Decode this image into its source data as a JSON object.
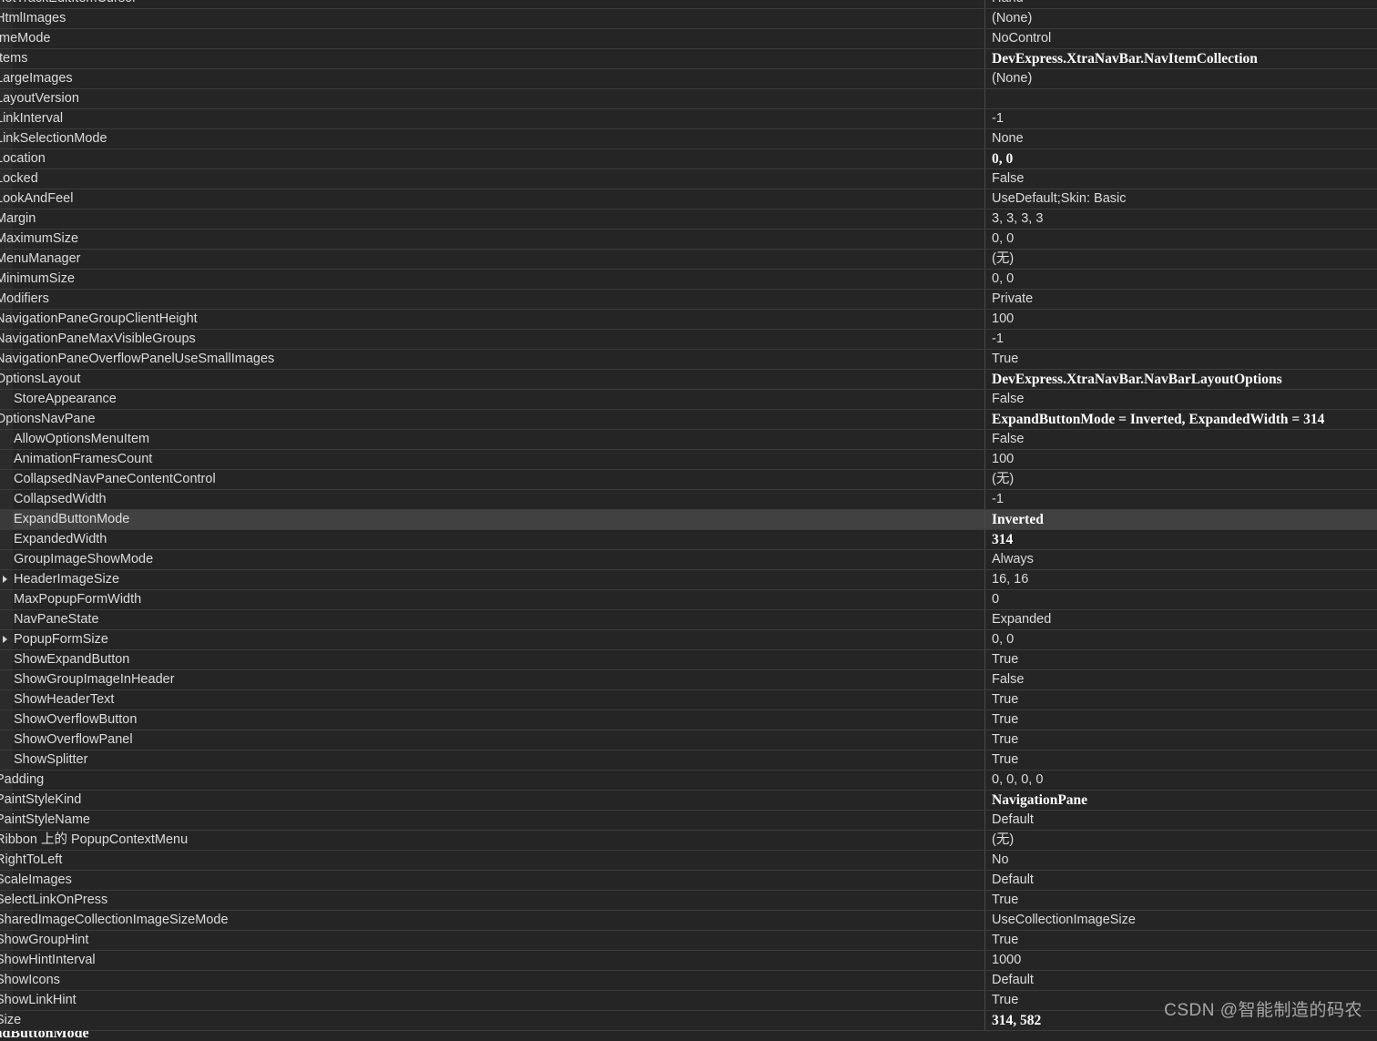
{
  "window": {
    "kind": "visual-studio-properties-grid",
    "theme": "dark",
    "background_color": "#252526",
    "selected_row_color": "#414141",
    "gridline_color": "#3b3b3c",
    "text_color": "#dcdcdc",
    "bold_text_color": "#ffffff"
  },
  "watermark": {
    "text": "CSDN @智能制造的码农"
  },
  "description_pane": {
    "title": "ExpandButtonMode"
  },
  "grid": {
    "selected_property": "ExpandButtonMode",
    "rows": [
      {
        "name": "HotTrackEditItemCursor",
        "value": "Hand",
        "indent": 0,
        "expandable": false,
        "bold": false,
        "selected": false
      },
      {
        "name": "HtmlImages",
        "value": "(None)",
        "indent": 0,
        "expandable": false,
        "bold": false,
        "selected": false
      },
      {
        "name": "ImeMode",
        "value": "NoControl",
        "indent": 0,
        "expandable": false,
        "bold": false,
        "selected": false
      },
      {
        "name": "Items",
        "value": "DevExpress.XtraNavBar.NavItemCollection",
        "indent": 0,
        "expandable": false,
        "bold": true,
        "selected": false
      },
      {
        "name": "LargeImages",
        "value": "(None)",
        "indent": 0,
        "expandable": false,
        "bold": false,
        "selected": false
      },
      {
        "name": "LayoutVersion",
        "value": "",
        "indent": 0,
        "expandable": false,
        "bold": false,
        "selected": false
      },
      {
        "name": "LinkInterval",
        "value": "-1",
        "indent": 0,
        "expandable": false,
        "bold": false,
        "selected": false
      },
      {
        "name": "LinkSelectionMode",
        "value": "None",
        "indent": 0,
        "expandable": false,
        "bold": false,
        "selected": false
      },
      {
        "name": "Location",
        "value": "0, 0",
        "indent": 0,
        "expandable": false,
        "bold": true,
        "selected": false
      },
      {
        "name": "Locked",
        "value": "False",
        "indent": 0,
        "expandable": false,
        "bold": false,
        "selected": false
      },
      {
        "name": "LookAndFeel",
        "value": "UseDefault;Skin: Basic",
        "indent": 0,
        "expandable": false,
        "bold": false,
        "selected": false
      },
      {
        "name": "Margin",
        "value": "3, 3, 3, 3",
        "indent": 0,
        "expandable": false,
        "bold": false,
        "selected": false
      },
      {
        "name": "MaximumSize",
        "value": "0, 0",
        "indent": 0,
        "expandable": false,
        "bold": false,
        "selected": false
      },
      {
        "name": "MenuManager",
        "value": "(无)",
        "indent": 0,
        "expandable": false,
        "bold": false,
        "selected": false
      },
      {
        "name": "MinimumSize",
        "value": "0, 0",
        "indent": 0,
        "expandable": false,
        "bold": false,
        "selected": false
      },
      {
        "name": "Modifiers",
        "value": "Private",
        "indent": 0,
        "expandable": false,
        "bold": false,
        "selected": false
      },
      {
        "name": "NavigationPaneGroupClientHeight",
        "value": "100",
        "indent": 0,
        "expandable": false,
        "bold": false,
        "selected": false
      },
      {
        "name": "NavigationPaneMaxVisibleGroups",
        "value": "-1",
        "indent": 0,
        "expandable": false,
        "bold": false,
        "selected": false
      },
      {
        "name": "NavigationPaneOverflowPanelUseSmallImages",
        "value": "True",
        "indent": 0,
        "expandable": false,
        "bold": false,
        "selected": false
      },
      {
        "name": "OptionsLayout",
        "value": "DevExpress.XtraNavBar.NavBarLayoutOptions",
        "indent": 0,
        "expandable": false,
        "bold": true,
        "selected": false
      },
      {
        "name": "StoreAppearance",
        "value": "False",
        "indent": 1,
        "expandable": false,
        "bold": false,
        "selected": false
      },
      {
        "name": "OptionsNavPane",
        "value": "ExpandButtonMode = Inverted, ExpandedWidth = 314",
        "indent": 0,
        "expandable": false,
        "bold": true,
        "selected": false
      },
      {
        "name": "AllowOptionsMenuItem",
        "value": "False",
        "indent": 1,
        "expandable": false,
        "bold": false,
        "selected": false
      },
      {
        "name": "AnimationFramesCount",
        "value": "100",
        "indent": 1,
        "expandable": false,
        "bold": false,
        "selected": false
      },
      {
        "name": "CollapsedNavPaneContentControl",
        "value": "(无)",
        "indent": 1,
        "expandable": false,
        "bold": false,
        "selected": false
      },
      {
        "name": "CollapsedWidth",
        "value": "-1",
        "indent": 1,
        "expandable": false,
        "bold": false,
        "selected": false
      },
      {
        "name": "ExpandButtonMode",
        "value": "Inverted",
        "indent": 1,
        "expandable": false,
        "bold": true,
        "selected": true
      },
      {
        "name": "ExpandedWidth",
        "value": "314",
        "indent": 1,
        "expandable": false,
        "bold": true,
        "selected": false
      },
      {
        "name": "GroupImageShowMode",
        "value": "Always",
        "indent": 1,
        "expandable": false,
        "bold": false,
        "selected": false
      },
      {
        "name": "HeaderImageSize",
        "value": "16, 16",
        "indent": 1,
        "expandable": true,
        "bold": false,
        "selected": false
      },
      {
        "name": "MaxPopupFormWidth",
        "value": "0",
        "indent": 1,
        "expandable": false,
        "bold": false,
        "selected": false
      },
      {
        "name": "NavPaneState",
        "value": "Expanded",
        "indent": 1,
        "expandable": false,
        "bold": false,
        "selected": false
      },
      {
        "name": "PopupFormSize",
        "value": "0, 0",
        "indent": 1,
        "expandable": true,
        "bold": false,
        "selected": false
      },
      {
        "name": "ShowExpandButton",
        "value": "True",
        "indent": 1,
        "expandable": false,
        "bold": false,
        "selected": false
      },
      {
        "name": "ShowGroupImageInHeader",
        "value": "False",
        "indent": 1,
        "expandable": false,
        "bold": false,
        "selected": false
      },
      {
        "name": "ShowHeaderText",
        "value": "True",
        "indent": 1,
        "expandable": false,
        "bold": false,
        "selected": false
      },
      {
        "name": "ShowOverflowButton",
        "value": "True",
        "indent": 1,
        "expandable": false,
        "bold": false,
        "selected": false
      },
      {
        "name": "ShowOverflowPanel",
        "value": "True",
        "indent": 1,
        "expandable": false,
        "bold": false,
        "selected": false
      },
      {
        "name": "ShowSplitter",
        "value": "True",
        "indent": 1,
        "expandable": false,
        "bold": false,
        "selected": false
      },
      {
        "name": "Padding",
        "value": "0, 0, 0, 0",
        "indent": 0,
        "expandable": false,
        "bold": false,
        "selected": false
      },
      {
        "name": "PaintStyleKind",
        "value": "NavigationPane",
        "indent": 0,
        "expandable": false,
        "bold": true,
        "selected": false
      },
      {
        "name": "PaintStyleName",
        "value": "Default",
        "indent": 0,
        "expandable": false,
        "bold": false,
        "selected": false
      },
      {
        "name": "Ribbon 上的 PopupContextMenu",
        "value": "(无)",
        "indent": 0,
        "expandable": false,
        "bold": false,
        "selected": false
      },
      {
        "name": "RightToLeft",
        "value": "No",
        "indent": 0,
        "expandable": false,
        "bold": false,
        "selected": false
      },
      {
        "name": "ScaleImages",
        "value": "Default",
        "indent": 0,
        "expandable": false,
        "bold": false,
        "selected": false
      },
      {
        "name": "SelectLinkOnPress",
        "value": "True",
        "indent": 0,
        "expandable": false,
        "bold": false,
        "selected": false
      },
      {
        "name": "SharedImageCollectionImageSizeMode",
        "value": "UseCollectionImageSize",
        "indent": 0,
        "expandable": false,
        "bold": false,
        "selected": false
      },
      {
        "name": "ShowGroupHint",
        "value": "True",
        "indent": 0,
        "expandable": false,
        "bold": false,
        "selected": false
      },
      {
        "name": "ShowHintInterval",
        "value": "1000",
        "indent": 0,
        "expandable": false,
        "bold": false,
        "selected": false
      },
      {
        "name": "ShowIcons",
        "value": "Default",
        "indent": 0,
        "expandable": false,
        "bold": false,
        "selected": false
      },
      {
        "name": "ShowLinkHint",
        "value": "True",
        "indent": 0,
        "expandable": false,
        "bold": false,
        "selected": false
      },
      {
        "name": "Size",
        "value": "314, 582",
        "indent": 0,
        "expandable": false,
        "bold": true,
        "selected": false
      }
    ]
  }
}
